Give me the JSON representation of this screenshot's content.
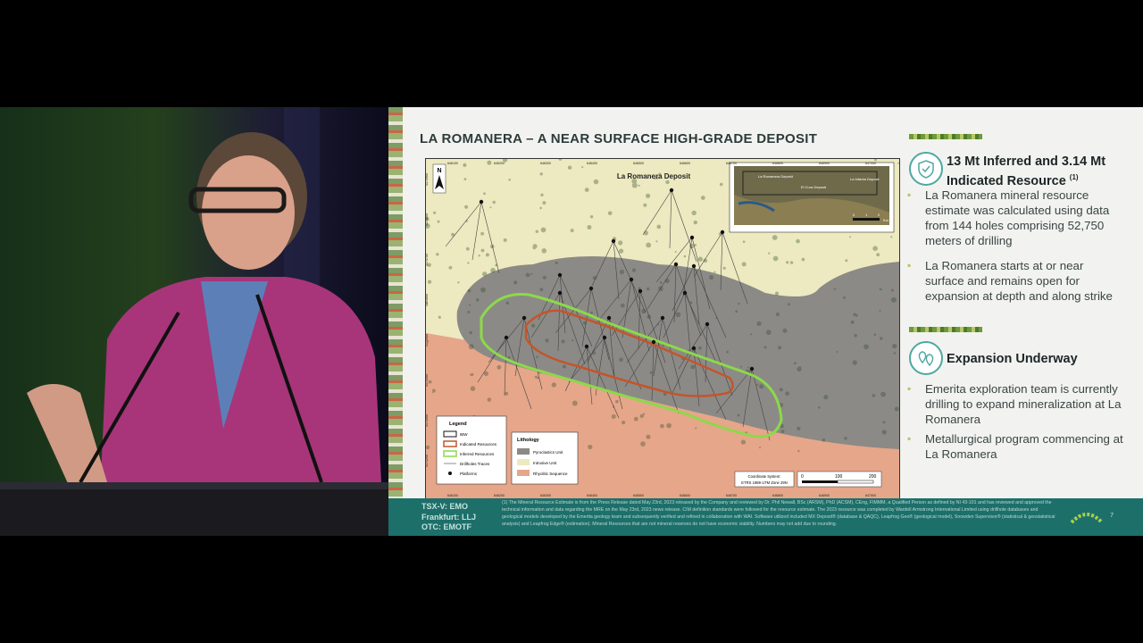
{
  "slide": {
    "title": "LA ROMANERA – A NEAR SURFACE HIGH-GRADE DEPOSIT",
    "page_number": "7"
  },
  "map": {
    "deposit_label": "La Romanera Deposit",
    "north_label": "N",
    "inset_labels": [
      "La Romanera Deposit",
      "El Cura Deposit",
      "La Infanta Deposit"
    ],
    "inset_scale": [
      "0",
      "1",
      "2",
      "Km"
    ],
    "x_ticks": [
      "646100",
      "646200",
      "646300",
      "646400",
      "646500",
      "646600",
      "646700",
      "646800",
      "646900",
      "647000"
    ],
    "y_ticks": [
      "4171900",
      "4171800",
      "4171700",
      "4171600",
      "4171500",
      "4171400",
      "4171300",
      "4171200"
    ],
    "legend": {
      "title": "Legend",
      "items": [
        "IBW",
        "Indicated Resources",
        "Inferred Resources",
        "Drillholes Traces",
        "Platforms"
      ]
    },
    "lithology": {
      "title": "Lithology",
      "items": [
        "Pyroclastics Unit",
        "Intrusive Unit",
        "Rhyolitic Sequence"
      ]
    },
    "coord_system": [
      "Coordinate System:",
      "ETRS 1989 UTM Zone 29N"
    ],
    "scale": [
      "0",
      "100",
      "200"
    ],
    "colors": {
      "pyroclastics": "#8c8a86",
      "intrusive": "#ede9c0",
      "rhyolitic": "#e6a68a",
      "indicated": "#c4552a",
      "inferred": "#8cd94a"
    }
  },
  "sections": [
    {
      "title_line1": "13 Mt Inferred and 3.14 Mt",
      "title_line2": "Indicated Resource",
      "title_sup": "(1)",
      "icon": "shield-check-icon",
      "bullets": [
        "La Romanera mineral resource estimate was calculated using data from 144 holes comprising 52,750 meters of drilling",
        "La Romanera starts at or near surface and remains open for expansion at depth and along strike"
      ]
    },
    {
      "title": "Expansion Underway",
      "icon": "map-pins-icon",
      "bullets": [
        "Emerita exploration team is currently drilling to expand mineralization at La Romanera",
        "Metallurgical program commencing at La Romanera"
      ]
    }
  ],
  "footer": {
    "tickers": [
      "TSX-V: EMO",
      "Frankfurt: LLJ",
      "OTC: EMOTF"
    ],
    "note": "(1) The Mineral Resource Estimate is from the Press Release dated May 23rd, 2023 released by the Company and reviewed by Dr. Phil Newall, BSc (ARSM), PhD (ACSM), CEng, FIMMM, a Qualified Person as defined by NI 43-101 and has reviewed and approved the technical information and data regarding the MRE on the May 23rd, 2023 news release. CIM definition standards were followed for the resource estimate. The 2023 resource was completed by Wardell Armstrong International Limited using drillhole databases and geological models developed by the Emerita geology team and subsequently verified and refined in collaboration with WAI. Software utilized included MX Deposit® (database & QAQC), Leapfrog Geo® (geological model), Snowden Supervisor® (statistical & geostatistical analysis) and Leapfrog Edge® (estimation). Mineral Resources that are not mineral reserves do not have economic viability. Numbers may not add due to rounding."
  }
}
